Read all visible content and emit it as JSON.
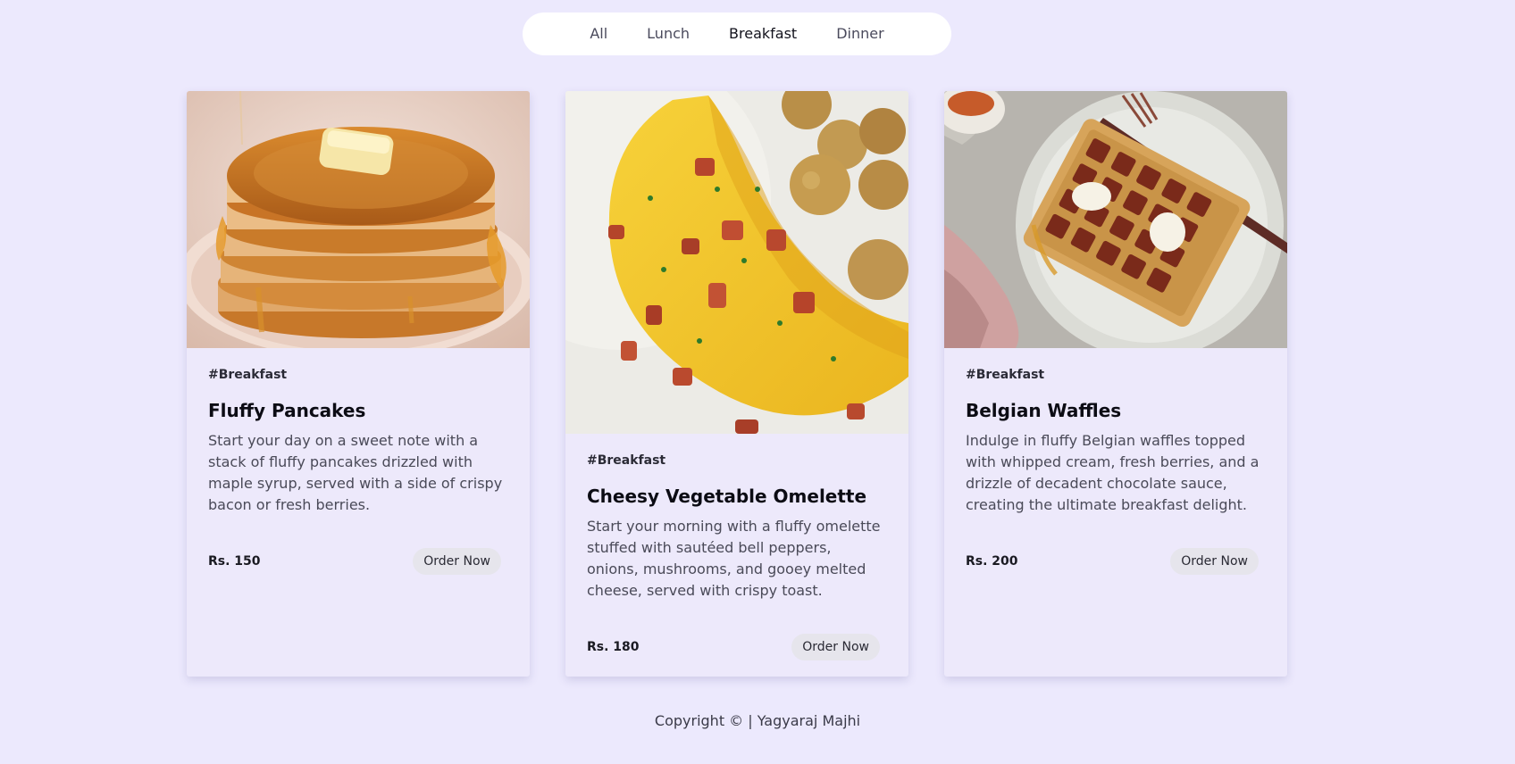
{
  "nav": {
    "tabs": [
      {
        "label": "All"
      },
      {
        "label": "Lunch"
      },
      {
        "label": "Breakfast"
      },
      {
        "label": "Dinner"
      }
    ],
    "active": "Breakfast"
  },
  "cards": [
    {
      "tag": "#Breakfast",
      "title": "Fluffy Pancakes",
      "description": "Start your day on a sweet note with a stack of fluffy pancakes drizzled with maple syrup, served with a side of crispy bacon or fresh berries.",
      "price": "Rs. 150",
      "button": "Order Now"
    },
    {
      "tag": "#Breakfast",
      "title": "Cheesy Vegetable Omelette",
      "description": "Start your morning with a fluffy omelette stuffed with sautéed bell peppers, onions, mushrooms, and gooey melted cheese, served with crispy toast.",
      "price": "Rs. 180",
      "button": "Order Now"
    },
    {
      "tag": "#Breakfast",
      "title": "Belgian Waffles",
      "description": "Indulge in fluffy Belgian waffles topped with whipped cream, fresh berries, and a drizzle of decadent chocolate sauce, creating the ultimate breakfast delight.",
      "price": "Rs. 200",
      "button": "Order Now"
    }
  ],
  "footer": {
    "text": "Copyright © | Yagyaraj Majhi"
  },
  "colors": {
    "background": "#ece9fd",
    "card": "#ede9fb",
    "nav": "#ffffff",
    "button": "#e6e5ec"
  }
}
